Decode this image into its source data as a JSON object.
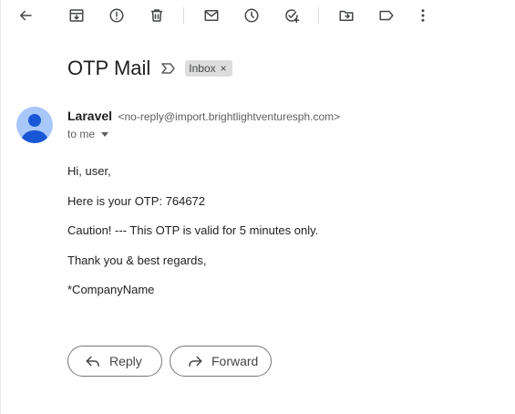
{
  "toolbar": {
    "icons": [
      "back-arrow-icon",
      "archive-icon",
      "report-spam-icon",
      "delete-icon",
      "mark-unread-icon",
      "snooze-icon",
      "add-task-icon",
      "move-to-icon",
      "label-icon",
      "more-options-icon"
    ]
  },
  "email": {
    "subject": "OTP Mail",
    "label_chip": "Inbox",
    "label_remove": "×",
    "sender_name": "Laravel",
    "sender_email": "<no-reply@import.brightlightventuresph.com>",
    "recipient": "to me",
    "body": {
      "greeting": "Hi, user,",
      "otp_line": "Here is your OTP: 764672",
      "caution": "Caution! --- This OTP is valid for 5 minutes only.",
      "closing": "Thank you & best regards,",
      "signature": "*CompanyName"
    }
  },
  "actions": {
    "reply_label": "Reply",
    "forward_label": "Forward"
  },
  "colors": {
    "avatar_bg": "#a8c7fa",
    "avatar_fg": "#1a57d6",
    "icon_color": "#444746"
  }
}
